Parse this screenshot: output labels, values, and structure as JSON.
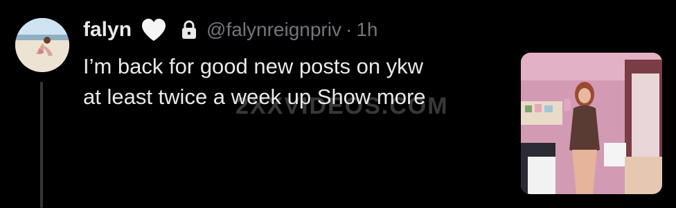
{
  "author": {
    "name": "falyn",
    "handle": "@falynreignpriv",
    "separator": "·",
    "time": "1h"
  },
  "post": {
    "line1": "I’m back for good new posts on ykw",
    "line2": "at least twice a week up ",
    "show_more": "Show more"
  },
  "watermark": "2XXVIDEOS.COM",
  "icons": {
    "heart": "white-heart-icon",
    "lock": "lock-icon"
  },
  "colors": {
    "background": "#000000",
    "primary_text": "#e7e9ea",
    "secondary_text": "#71767b",
    "thread_line": "#333639"
  }
}
